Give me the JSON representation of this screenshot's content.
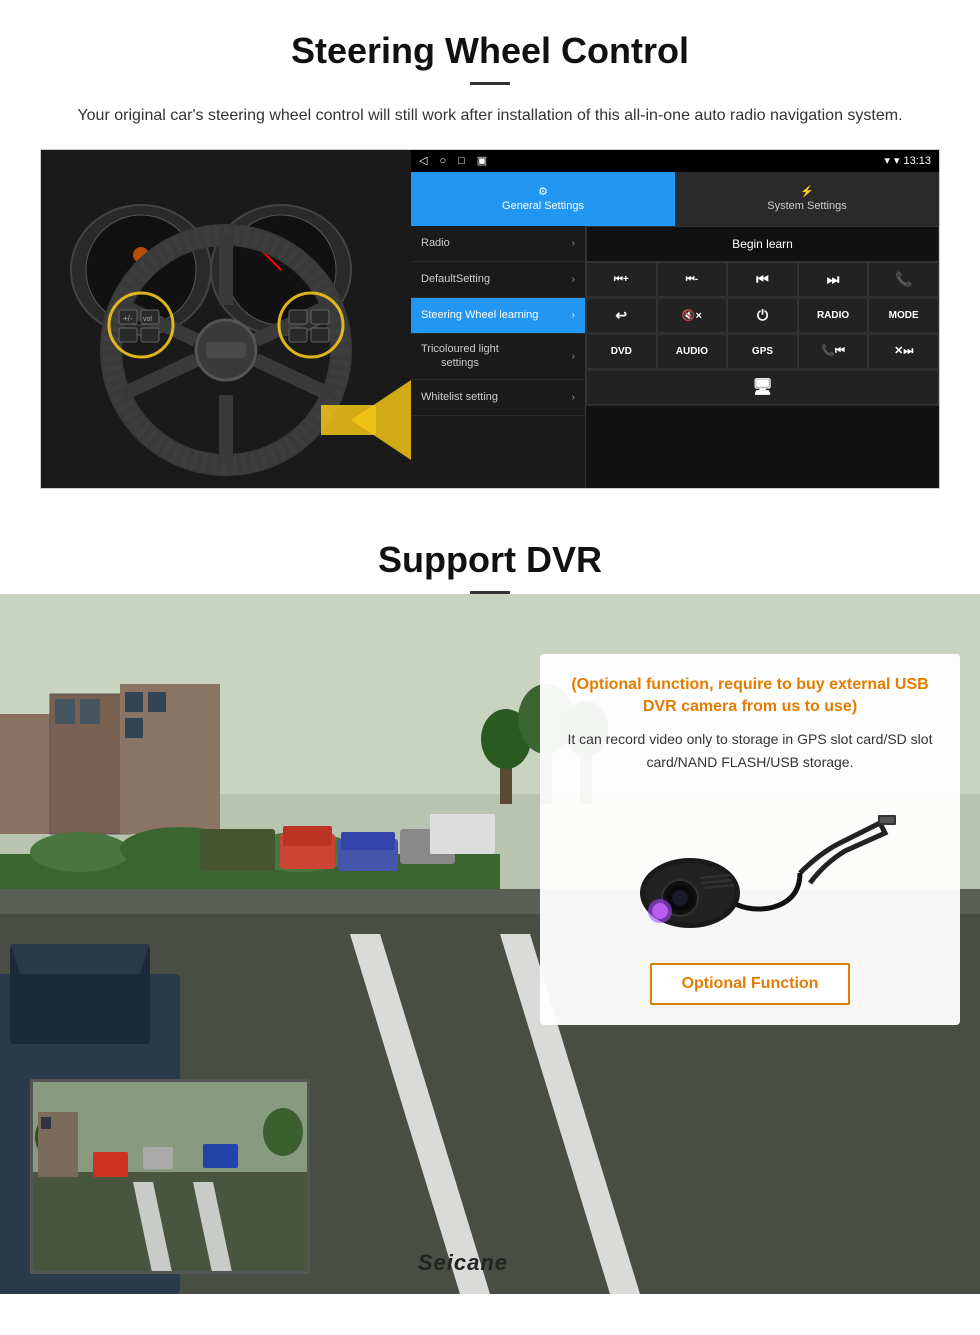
{
  "page": {
    "section1": {
      "title": "Steering Wheel Control",
      "subtitle": "Your original car's steering wheel control will still work after installation of this all-in-one auto radio navigation system."
    },
    "section2": {
      "title": "Support DVR",
      "optional_title": "(Optional function, require to buy external USB DVR camera from us to use)",
      "description": "It can record video only to storage in GPS slot card/SD slot card/NAND FLASH/USB storage.",
      "brand": "Seicane",
      "optional_button": "Optional Function"
    },
    "android_ui": {
      "status_bar": {
        "time": "13:13",
        "nav_back": "◁",
        "nav_home": "○",
        "nav_square": "□",
        "nav_menu": "≡"
      },
      "tab_general": "General Settings",
      "tab_system": "System Settings",
      "menu_items": [
        {
          "label": "Radio",
          "active": false
        },
        {
          "label": "DefaultSetting",
          "active": false
        },
        {
          "label": "Steering Wheel learning",
          "active": true
        },
        {
          "label": "Tricoloured light settings",
          "active": false
        },
        {
          "label": "Whitelist setting",
          "active": false
        }
      ],
      "begin_learn": "Begin learn",
      "button_rows": [
        [
          "⏮+",
          "⏮-",
          "⏮⏮",
          "⏭⏭",
          "📞"
        ],
        [
          "↩",
          "🔇×",
          "⏻",
          "RADIO",
          "MODE"
        ],
        [
          "DVD",
          "AUDIO",
          "GPS",
          "📞⏮",
          "✕⏭"
        ]
      ]
    }
  }
}
